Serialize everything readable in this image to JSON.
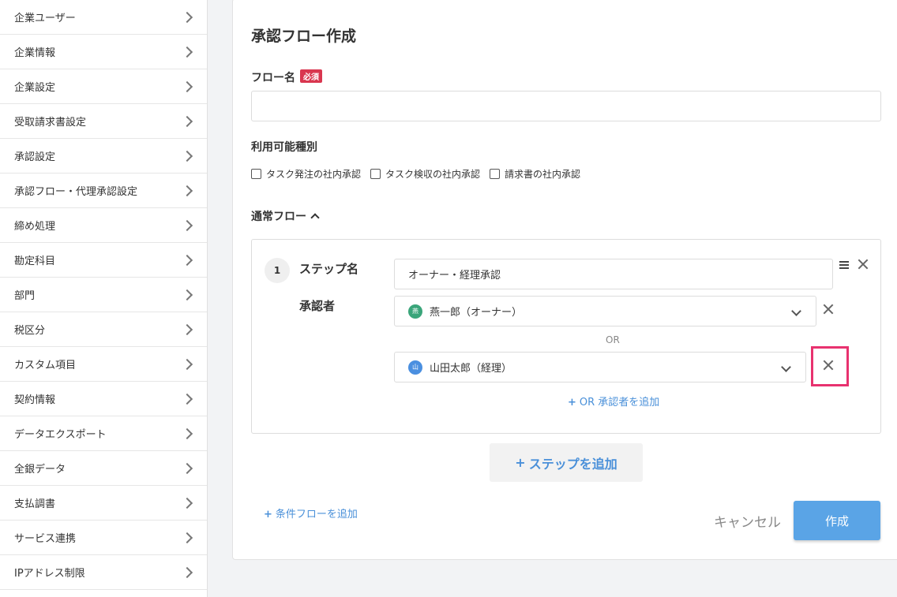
{
  "sidebar": {
    "items": [
      {
        "label": "企業ユーザー"
      },
      {
        "label": "企業情報"
      },
      {
        "label": "企業設定"
      },
      {
        "label": "受取請求書設定"
      },
      {
        "label": "承認設定"
      },
      {
        "label": "承認フロー・代理承認設定"
      },
      {
        "label": "締め処理"
      },
      {
        "label": "勘定科目"
      },
      {
        "label": "部門"
      },
      {
        "label": "税区分"
      },
      {
        "label": "カスタム項目"
      },
      {
        "label": "契約情報"
      },
      {
        "label": "データエクスポート"
      },
      {
        "label": "全銀データ"
      },
      {
        "label": "支払調書"
      },
      {
        "label": "サービス連携"
      },
      {
        "label": "IPアドレス制限"
      }
    ]
  },
  "main": {
    "title": "承認フロー作成",
    "flow_name_label": "フロー名",
    "required_badge": "必須",
    "flow_name_value": "",
    "types_label": "利用可能種別",
    "checkboxes": [
      {
        "label": "タスク発注の社内承認",
        "checked": false
      },
      {
        "label": "タスク検収の社内承認",
        "checked": false
      },
      {
        "label": "請求書の社内承認",
        "checked": false
      }
    ],
    "normal_flow_label": "通常フロー",
    "step": {
      "number": "1",
      "name_label": "ステップ名",
      "name_value": "オーナー・経理承認",
      "approver_label": "承認者",
      "or_text": "OR",
      "approvers": [
        {
          "avatar_text": "燕",
          "avatar_color": "#3aa57a",
          "name": "燕一郎（オーナー）"
        },
        {
          "avatar_text": "山",
          "avatar_color": "#4a8fe0",
          "name": "山田太郎（経理）"
        }
      ],
      "add_or_label": "OR 承認者を追加"
    },
    "add_step_label": "ステップを追加",
    "add_condition_label": "条件フローを追加",
    "cancel_label": "キャンセル",
    "create_label": "作成"
  },
  "colors": {
    "accent": "#4a90d9",
    "primary_button": "#5aa4e6",
    "required_badge": "#d9364f",
    "highlight": "#e8326f"
  }
}
